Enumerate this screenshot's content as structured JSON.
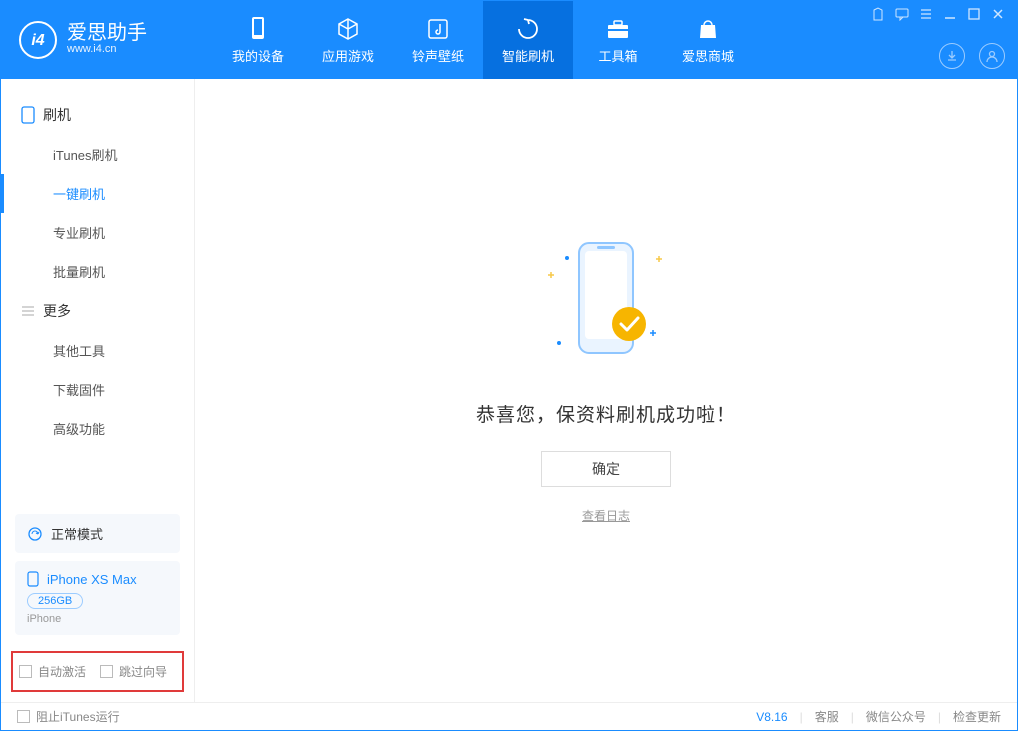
{
  "header": {
    "logo_cn": "爱思助手",
    "logo_en": "www.i4.cn",
    "tabs": [
      {
        "label": "我的设备"
      },
      {
        "label": "应用游戏"
      },
      {
        "label": "铃声壁纸"
      },
      {
        "label": "智能刷机"
      },
      {
        "label": "工具箱"
      },
      {
        "label": "爱思商城"
      }
    ]
  },
  "sidebar": {
    "group1_title": "刷机",
    "group1_items": [
      "iTunes刷机",
      "一键刷机",
      "专业刷机",
      "批量刷机"
    ],
    "group2_title": "更多",
    "group2_items": [
      "其他工具",
      "下载固件",
      "高级功能"
    ],
    "mode_label": "正常模式",
    "device_name": "iPhone XS Max",
    "device_capacity": "256GB",
    "device_type": "iPhone",
    "checkbox1": "自动激活",
    "checkbox2": "跳过向导"
  },
  "main": {
    "success_text": "恭喜您，保资料刷机成功啦！",
    "ok_button": "确定",
    "view_log": "查看日志"
  },
  "footer": {
    "block_itunes": "阻止iTunes运行",
    "version": "V8.16",
    "support": "客服",
    "wechat": "微信公众号",
    "check_update": "检查更新"
  }
}
